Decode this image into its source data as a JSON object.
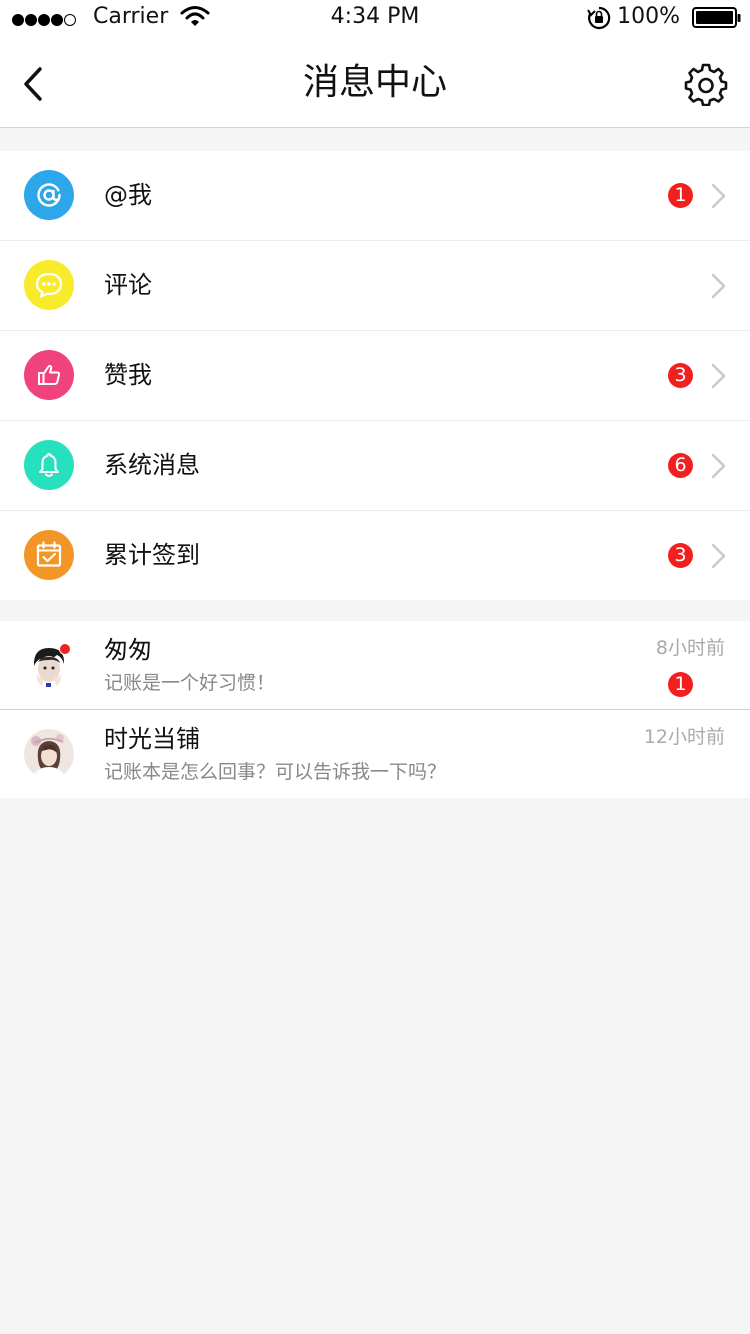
{
  "status_bar": {
    "carrier": "Carrier",
    "time": "4:34 PM",
    "battery": "100%"
  },
  "nav": {
    "title": "消息中心",
    "back_icon": "chevron-left-icon",
    "settings_icon": "gear-icon"
  },
  "menu": [
    {
      "label": "@我",
      "badge": "1",
      "color": "#2ea7ea",
      "icon": "at-icon"
    },
    {
      "label": "评论",
      "badge": "",
      "color": "#f7eb2b",
      "icon": "comment-bubble-icon"
    },
    {
      "label": "赞我",
      "badge": "3",
      "color": "#f0427c",
      "icon": "thumbs-up-icon"
    },
    {
      "label": "系统消息",
      "badge": "6",
      "color": "#27e0be",
      "icon": "bell-icon"
    },
    {
      "label": "累计签到",
      "badge": "3",
      "color": "#f29727",
      "icon": "calendar-check-icon"
    }
  ],
  "conversations": [
    {
      "name": "匆匆",
      "preview": "记账是一个好习惯！",
      "time": "8小时前",
      "badge": "1"
    },
    {
      "name": "时光当铺",
      "preview": "记账本是怎么回事？可以告诉我一下吗？",
      "time": "12小时前",
      "badge": ""
    }
  ],
  "colors": {
    "badge": "#f21f1f",
    "background": "#f5f5f5"
  }
}
